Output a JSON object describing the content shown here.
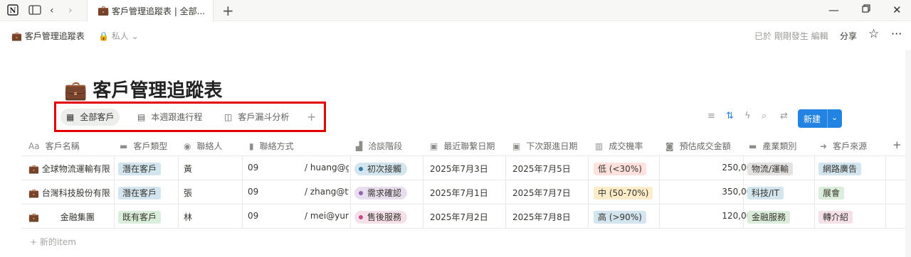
{
  "browser": {
    "tab_title": "客戶管理追蹤表 | 全部...",
    "icons": {
      "notion": "notion-logo-icon",
      "sidebar": "sidebar-toggle-icon",
      "back": "back-arrow-icon",
      "forward": "forward-arrow-icon",
      "new_tab": "plus-icon",
      "minimize": "minimize-icon",
      "restore": "restore-icon",
      "close": "close-icon"
    }
  },
  "topbar": {
    "breadcrumb": "客戶管理追蹤表",
    "privacy": "私人",
    "edited": "已於 剛剛發生 編輯",
    "share": "分享"
  },
  "page": {
    "title": "客戶管理追蹤表",
    "views": [
      {
        "label": "全部客戶",
        "icon": "table-icon"
      },
      {
        "label": "本週跟進行程",
        "icon": "calendar-icon"
      },
      {
        "label": "客戶漏斗分析",
        "icon": "board-icon"
      }
    ],
    "new_button": "新建",
    "new_item": "新的item"
  },
  "table": {
    "columns": [
      "客戶名稱",
      "客戶類型",
      "聯絡人",
      "聯絡方式",
      "洽談階段",
      "最近聯繫日期",
      "下次跟進日期",
      "成交機率",
      "預估成交金額",
      "產業類別",
      "客戶來源"
    ],
    "rows": [
      {
        "name": "全球物流運輸有限",
        "type": "潛在客戶",
        "contact": "黃",
        "phone": "09",
        "email": "/ huang@g",
        "stage": "初次接觸",
        "last": "2025年7月3日",
        "next": "2025年7月5日",
        "prob": "低 (<30%)",
        "amount": "250,000",
        "industry": "物流/運輸",
        "source": "網路廣告"
      },
      {
        "name": "台灣科技股份有限",
        "type": "潛在客戶",
        "contact": "張",
        "phone": "09",
        "email": "/ zhang@tv",
        "stage": "需求確認",
        "last": "2025年7月1日",
        "next": "2025年7月7日",
        "prob": "中 (50-70%)",
        "amount": "350,000",
        "industry": "科技/IT",
        "source": "展會"
      },
      {
        "name": "金融集團",
        "type": "既有客戶",
        "contact": "林",
        "phone": "09",
        "email": "/ mei@yun",
        "stage": "售後服務",
        "last": "2025年7月2日",
        "next": "2025年7月8日",
        "prob": "高 (>90%)",
        "amount": "120,000",
        "industry": "金融服務",
        "source": "轉介紹"
      }
    ]
  },
  "colors": {
    "accent": "#2383e2",
    "highlight_border": "#e50000",
    "tag_blue": "#d3e5ef",
    "tag_green": "#dbeddb",
    "tag_gray": "#e3e2e0",
    "tag_red": "#ffe2dd",
    "tag_yellow": "#fdecc8",
    "tag_purple": "#e8deee",
    "tag_pink": "#f5e0e9"
  }
}
